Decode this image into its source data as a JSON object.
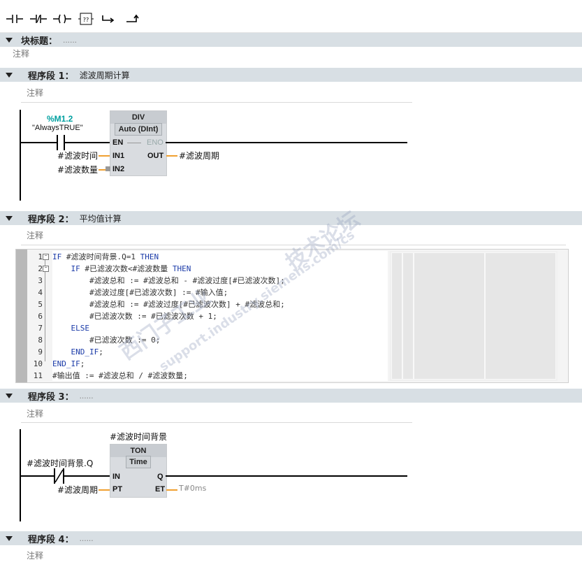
{
  "toolbar": {
    "buttons": [
      {
        "name": "no-contact-button",
        "glyph": "⊣⊢"
      },
      {
        "name": "nc-contact-button",
        "glyph": "⊣/⊢"
      },
      {
        "name": "coil-button",
        "glyph": "–( )–"
      },
      {
        "name": "empty-box-button",
        "glyph": "??"
      },
      {
        "name": "open-branch-button",
        "glyph": "↪"
      },
      {
        "name": "close-branch-button",
        "glyph": "⮥"
      }
    ]
  },
  "block": {
    "title_label": "块标题：",
    "title_value": "......",
    "comment": "注释"
  },
  "networks": [
    {
      "title": "程序段 1：",
      "name": "滤波周期计算",
      "comment": "注释",
      "contact": {
        "address": "%M1.2",
        "symbol": "\"AlwaysTRUE\""
      },
      "box": {
        "name": "DIV",
        "type": "Auto (DInt)",
        "en": "EN",
        "eno": "ENO",
        "in1": "IN1",
        "in2": "IN2",
        "out": "OUT"
      },
      "in1_var": "#滤波时间",
      "in2_var": "#滤波数量",
      "out_var": "#滤波周期"
    },
    {
      "title": "程序段 2：",
      "name": "平均值计算",
      "comment": "注释",
      "code_lines": [
        {
          "n": "1",
          "text": "IF #滤波时间背景.Q=1 THEN"
        },
        {
          "n": "2",
          "text": "    IF #已滤波次数<#滤波数量 THEN"
        },
        {
          "n": "3",
          "text": "        #滤波总和 := #滤波总和 - #滤波过度[#已滤波次数];"
        },
        {
          "n": "4",
          "text": "        #滤波过度[#已滤波次数] := #输入值;"
        },
        {
          "n": "5",
          "text": "        #滤波总和 := #滤波过度[#已滤波次数] + #滤波总和;"
        },
        {
          "n": "6",
          "text": "        #已滤波次数 := #已滤波次数 + 1;"
        },
        {
          "n": "7",
          "text": "    ELSE"
        },
        {
          "n": "8",
          "text": "        #已滤波次数 := 0;"
        },
        {
          "n": "9",
          "text": "    END_IF;"
        },
        {
          "n": "10",
          "text": "END_IF;"
        },
        {
          "n": "11",
          "text": "#输出值 := #滤波总和 / #滤波数量;"
        }
      ]
    },
    {
      "title": "程序段 3：",
      "name": "......",
      "comment": "注释",
      "instance": "#滤波时间背景",
      "contact_var": "#滤波时间背景.Q",
      "box": {
        "name": "TON",
        "type": "Time",
        "in": "IN",
        "pt": "PT",
        "q": "Q",
        "et": "ET"
      },
      "pt_var": "#滤波周期",
      "et_value": "T#0ms"
    },
    {
      "title": "程序段 4：",
      "name": "......",
      "comment": "注释"
    }
  ],
  "watermark": {
    "text1": "西门子工业",
    "text2": "技术论坛",
    "text3": "support.industry.siemens.com/cs"
  },
  "colors": {
    "header_bg": "#d8dfe4",
    "accent_orange": "#f0a030",
    "address_teal": "#00a0a0",
    "keyword_blue": "#1a3aa8"
  }
}
